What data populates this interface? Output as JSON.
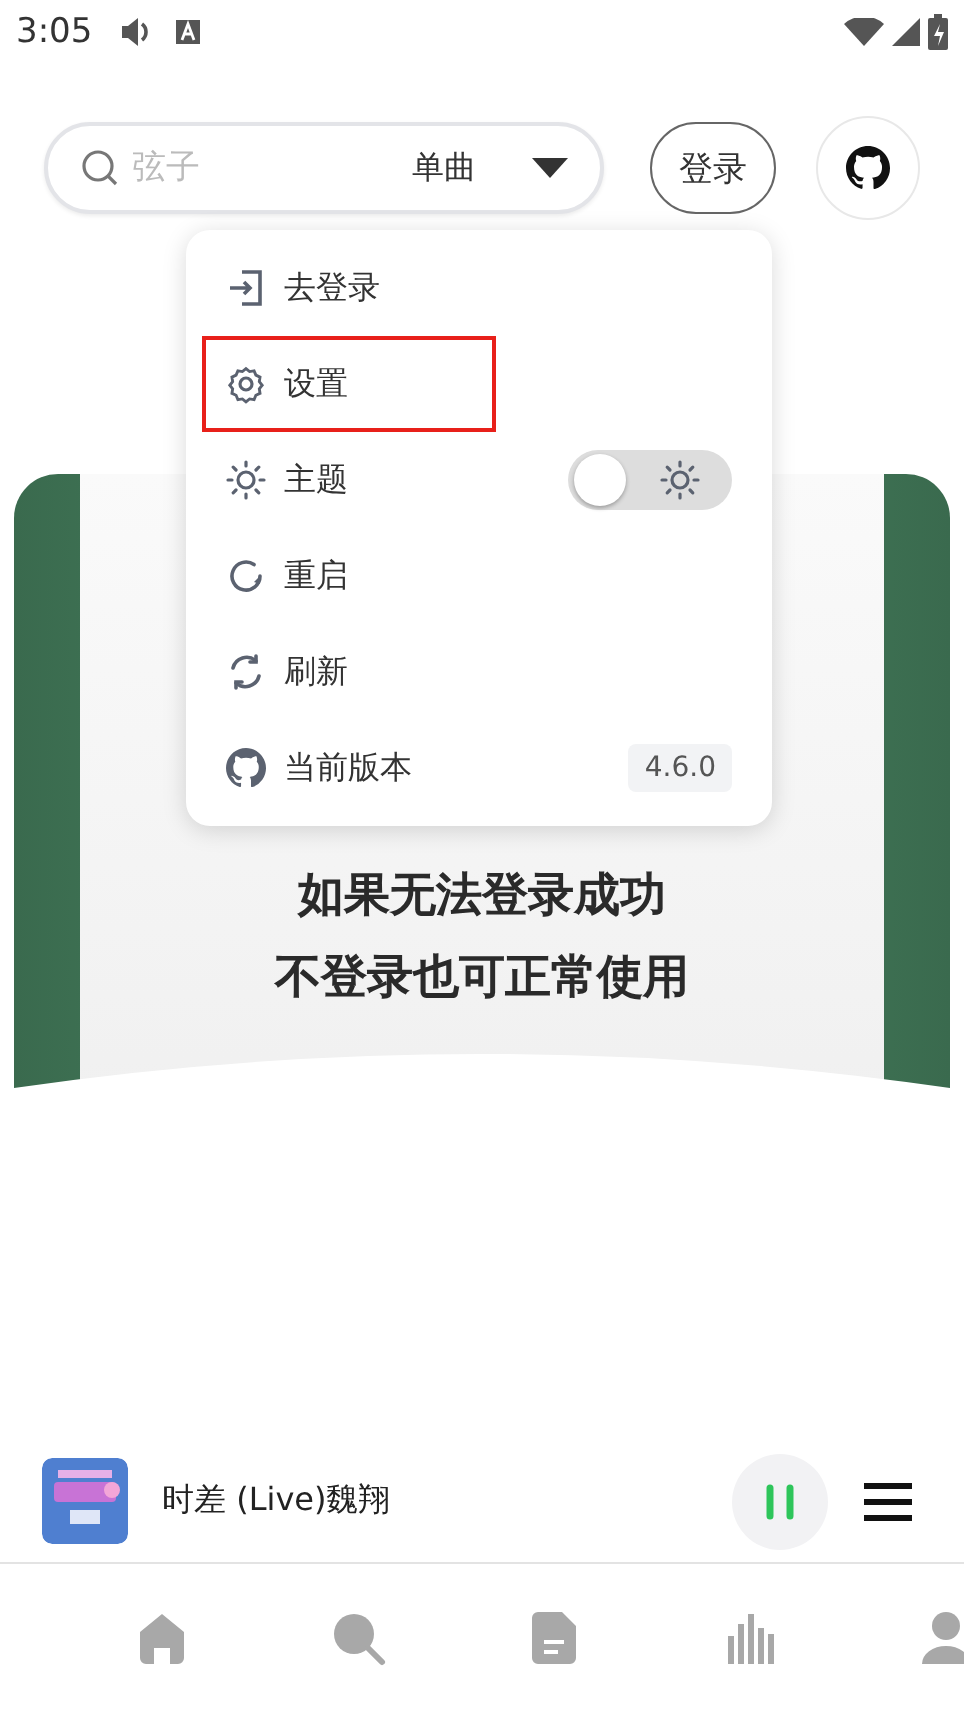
{
  "status_bar": {
    "time": "3:05"
  },
  "header": {
    "search": {
      "placeholder": "弦子"
    },
    "search_type": "单曲",
    "login_button": "登录"
  },
  "menu": {
    "items": [
      {
        "kind": "login",
        "label": "去登录",
        "highlighted": false
      },
      {
        "kind": "settings",
        "label": "设置",
        "highlighted": true
      },
      {
        "kind": "theme",
        "label": "主题",
        "highlighted": false,
        "on": false
      },
      {
        "kind": "restart",
        "label": "重启",
        "highlighted": false
      },
      {
        "kind": "refresh",
        "label": "刷新",
        "highlighted": false
      },
      {
        "kind": "version",
        "label": "当前版本",
        "highlighted": false,
        "badge": "4.6.0"
      }
    ]
  },
  "banner": {
    "lines": [
      "如果无法登录成功",
      "不登录也可正常使用"
    ]
  },
  "player": {
    "title": "时差 (Live)魏翔",
    "playing": true
  },
  "nav": {
    "items": [
      {
        "kind": "home"
      },
      {
        "kind": "search"
      },
      {
        "kind": "document"
      },
      {
        "kind": "chart"
      },
      {
        "kind": "person"
      }
    ]
  }
}
